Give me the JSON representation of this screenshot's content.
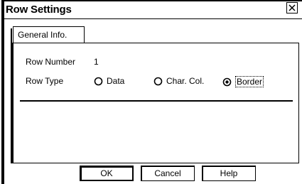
{
  "window": {
    "title": "Row Settings"
  },
  "tabs": [
    {
      "label": "General Info."
    }
  ],
  "fields": {
    "row_number_label": "Row Number",
    "row_number_value": "1",
    "row_type_label": "Row Type"
  },
  "row_type_options": [
    {
      "label": "Data",
      "selected": false
    },
    {
      "label": "Char. Col.",
      "selected": false
    },
    {
      "label": "Border",
      "selected": true
    }
  ],
  "buttons": {
    "ok": "OK",
    "cancel": "Cancel",
    "help": "Help"
  },
  "icons": {
    "close": "close-icon"
  }
}
